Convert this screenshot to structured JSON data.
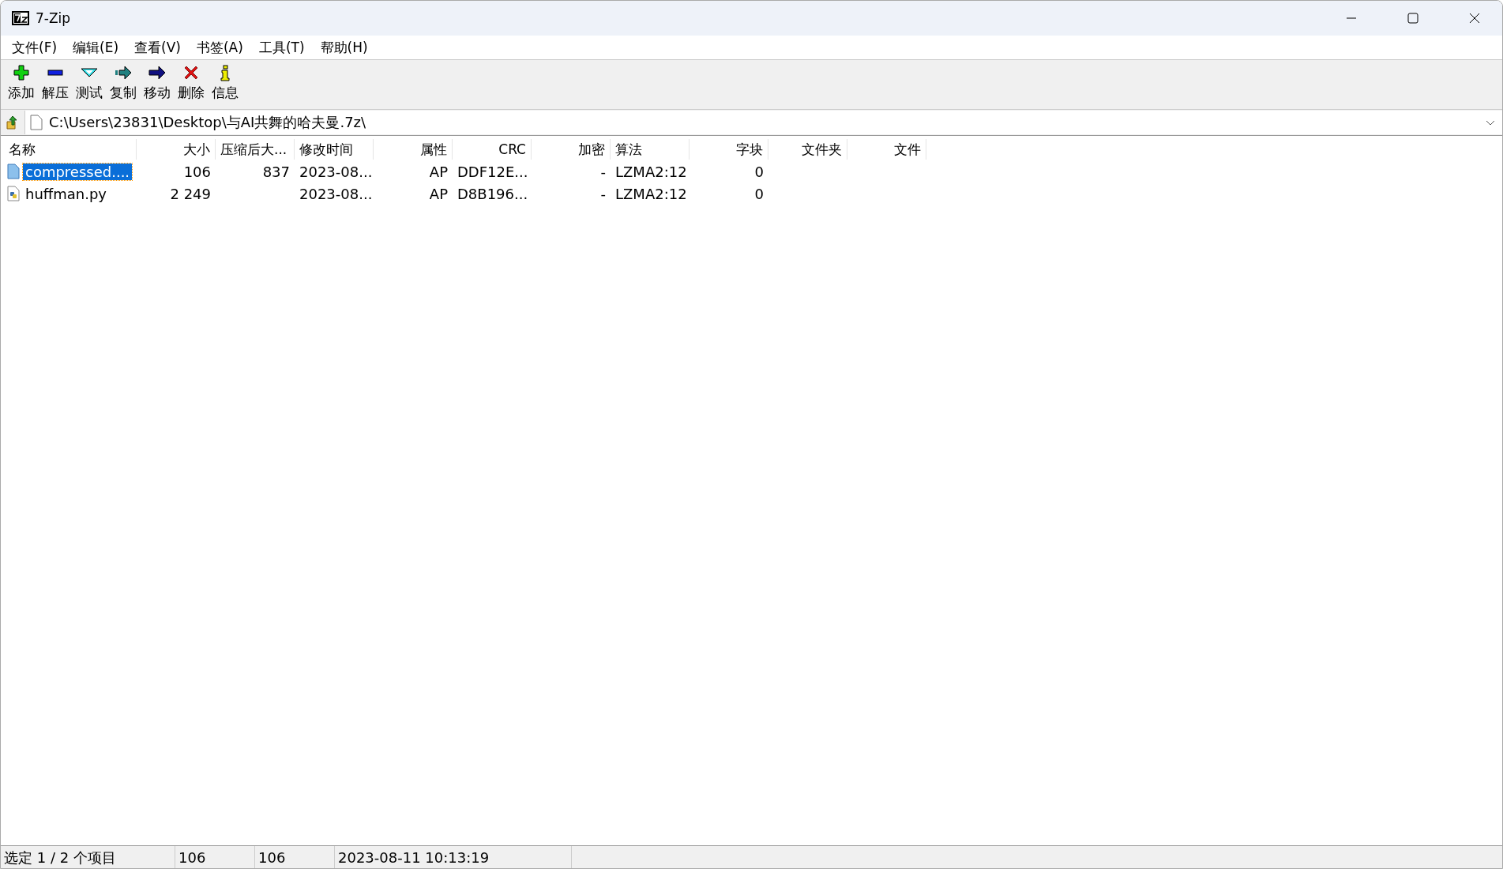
{
  "window": {
    "title": "7-Zip"
  },
  "menu": [
    "文件(F)",
    "编辑(E)",
    "查看(V)",
    "书签(A)",
    "工具(T)",
    "帮助(H)"
  ],
  "toolbar": [
    {
      "kind": "add",
      "label": "添加"
    },
    {
      "kind": "extract",
      "label": "解压"
    },
    {
      "kind": "test",
      "label": "测试"
    },
    {
      "kind": "copy",
      "label": "复制"
    },
    {
      "kind": "move",
      "label": "移动"
    },
    {
      "kind": "delete",
      "label": "删除"
    },
    {
      "kind": "info",
      "label": "信息"
    }
  ],
  "address": {
    "value": "C:\\Users\\23831\\Desktop\\与AI共舞的哈夫曼.7z\\"
  },
  "table": {
    "columns": [
      "名称",
      "大小",
      "压缩后大...",
      "修改时间",
      "属性",
      "CRC",
      "加密",
      "算法",
      "字块",
      "文件夹",
      "文件"
    ],
    "rows": [
      {
        "kind": "file",
        "selected": true,
        "cells": [
          "compressed....",
          "106",
          "837",
          "2023-08...",
          "AP",
          "DDF12E...",
          "-",
          "LZMA2:12",
          "0",
          "",
          ""
        ]
      },
      {
        "kind": "python",
        "selected": false,
        "cells": [
          "huffman.py",
          "2 249",
          "",
          "2023-08...",
          "AP",
          "D8B196...",
          "-",
          "LZMA2:12",
          "0",
          "",
          ""
        ]
      }
    ]
  },
  "status_bar": [
    "选定 1 / 2 个项目",
    "106",
    "106",
    "2023-08-11 10:13:19"
  ]
}
